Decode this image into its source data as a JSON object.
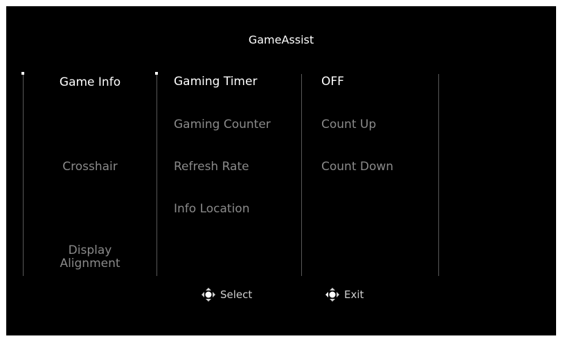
{
  "title": "GameAssist",
  "menu": {
    "col1": [
      {
        "label": "Game Info",
        "active": true
      },
      {
        "label": "Crosshair",
        "active": false
      },
      {
        "label": "Display\nAlignment",
        "active": false
      }
    ],
    "col2": [
      {
        "label": "Gaming Timer",
        "active": true
      },
      {
        "label": "Gaming Counter",
        "active": false
      },
      {
        "label": "Refresh Rate",
        "active": false
      },
      {
        "label": "Info Location",
        "active": false
      }
    ],
    "col3": [
      {
        "label": "OFF",
        "active": true
      },
      {
        "label": "Count Up",
        "active": false
      },
      {
        "label": "Count Down",
        "active": false
      }
    ]
  },
  "footer": {
    "select_label": "Select",
    "exit_label": "Exit"
  },
  "icons": {
    "select": "dpad-icon",
    "exit": "dpad-icon"
  }
}
